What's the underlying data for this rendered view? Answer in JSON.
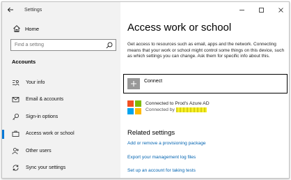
{
  "window": {
    "title": "Settings"
  },
  "sidebar": {
    "home_label": "Home",
    "search_placeholder": "Find a setting",
    "section_title": "Accounts",
    "items": [
      {
        "label": "Your info",
        "icon": "person-card-icon",
        "active": false
      },
      {
        "label": "Email & accounts",
        "icon": "mail-icon",
        "active": false
      },
      {
        "label": "Sign-in options",
        "icon": "key-icon",
        "active": false
      },
      {
        "label": "Access work or school",
        "icon": "briefcase-icon",
        "active": true
      },
      {
        "label": "Other users",
        "icon": "person-add-icon",
        "active": false
      },
      {
        "label": "Sync your settings",
        "icon": "sync-icon",
        "active": false
      }
    ]
  },
  "main": {
    "title": "Access work or school",
    "description": "Get access to resources such as email, apps and the network. Connecting means that your work or school might control some things on this device, such as which settings you can change. Ask them for specific info about this.",
    "connect_label": "Connect",
    "account": {
      "name": "Connected to Prod's Azure AD",
      "connected_by_prefix": "Connected by"
    },
    "related_title": "Related settings",
    "links": [
      "Add or remove a provisioning package",
      "Export your management log files",
      "Set up an account for taking tests"
    ]
  },
  "colors": {
    "accent": "#0078d7",
    "link": "#0063b1",
    "sidebar_bg": "#f2f2f2",
    "highlight": "#f7f029",
    "ms_red": "#f25022",
    "ms_green": "#7fba00",
    "ms_blue": "#00a4ef",
    "ms_yellow": "#ffb900"
  }
}
